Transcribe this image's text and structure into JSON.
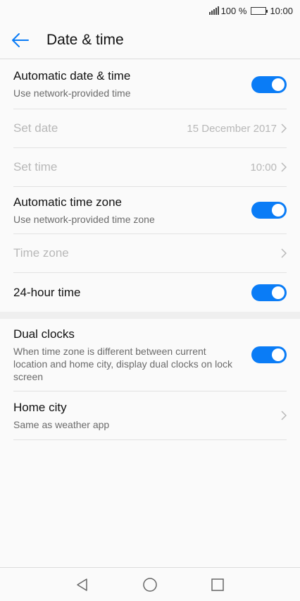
{
  "status_bar": {
    "battery_text": "100 %",
    "time": "10:00"
  },
  "app_bar": {
    "title": "Date & time",
    "back_icon": "arrow-left-icon"
  },
  "settings": {
    "automatic_date_time": {
      "title": "Automatic date & time",
      "subtitle": "Use network-provided time",
      "enabled": true
    },
    "set_date": {
      "title": "Set date",
      "value": "15 December 2017"
    },
    "set_time": {
      "title": "Set time",
      "value": "10:00"
    },
    "automatic_time_zone": {
      "title": "Automatic time zone",
      "subtitle": "Use network-provided time zone",
      "enabled": true
    },
    "time_zone": {
      "title": "Time zone"
    },
    "hour_24": {
      "title": "24-hour time",
      "enabled": true
    },
    "dual_clocks": {
      "title": "Dual clocks",
      "subtitle": "When time zone is different between current location and home city, display dual clocks on lock screen",
      "enabled": true
    },
    "home_city": {
      "title": "Home city",
      "subtitle": "Same as weather app"
    }
  },
  "colors": {
    "accent": "#0a7cf6",
    "disabled_text": "#b8b8b8"
  },
  "nav_bar": {
    "back_icon": "triangle-back-icon",
    "home_icon": "circle-home-icon",
    "recents_icon": "square-recents-icon"
  }
}
